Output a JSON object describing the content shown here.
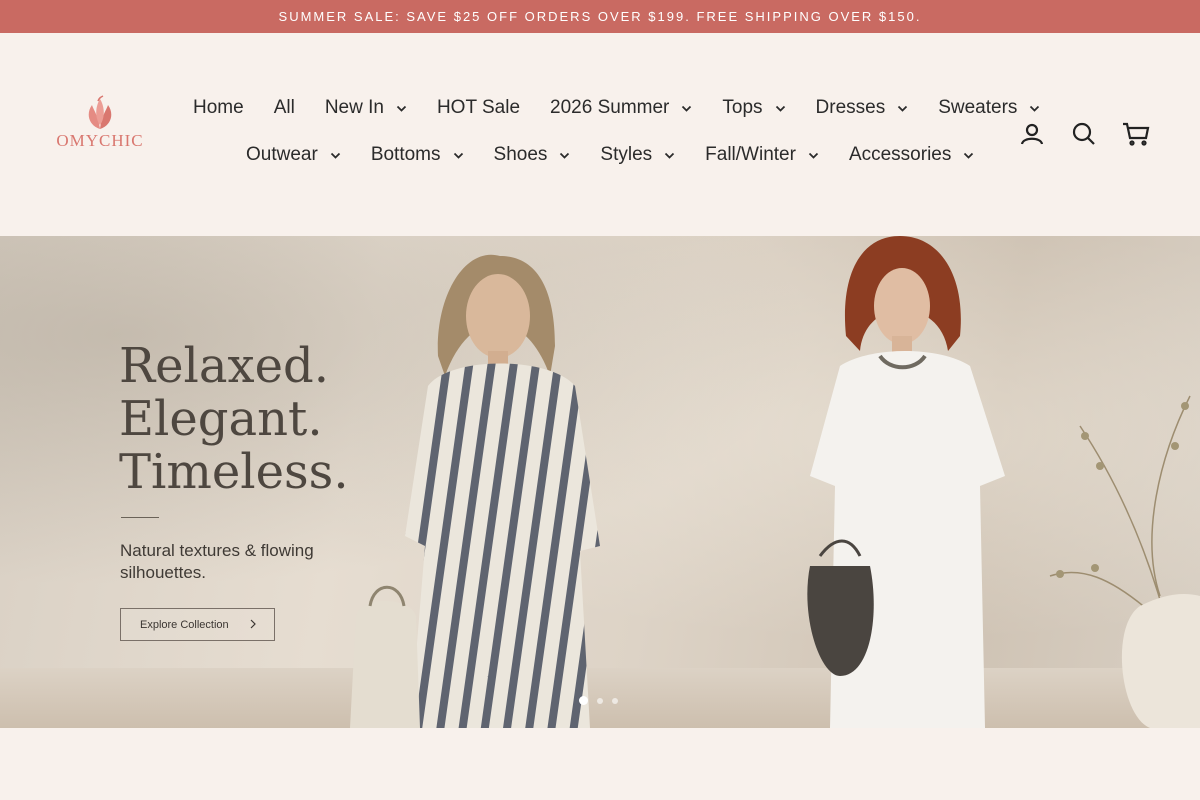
{
  "announcement": "SUMMER SALE: SAVE $25 OFF ORDERS OVER $199. FREE SHIPPING OVER $150.",
  "brand": {
    "logo_text": "OMYCHIC",
    "accent": "#d9776f"
  },
  "nav": {
    "row1": [
      {
        "label": "Home",
        "dropdown": false
      },
      {
        "label": "All",
        "dropdown": false
      },
      {
        "label": "New In",
        "dropdown": true
      },
      {
        "label": "HOT Sale",
        "dropdown": false
      },
      {
        "label": "2026 Summer",
        "dropdown": true
      },
      {
        "label": "Tops",
        "dropdown": true
      },
      {
        "label": "Dresses",
        "dropdown": true
      },
      {
        "label": "Sweaters",
        "dropdown": true
      }
    ],
    "row2": [
      {
        "label": "Outwear",
        "dropdown": true
      },
      {
        "label": "Bottoms",
        "dropdown": true
      },
      {
        "label": "Shoes",
        "dropdown": true
      },
      {
        "label": "Styles",
        "dropdown": true
      },
      {
        "label": "Fall/Winter",
        "dropdown": true
      },
      {
        "label": "Accessories",
        "dropdown": true
      }
    ]
  },
  "header_icons": [
    "account-icon",
    "search-icon",
    "cart-icon"
  ],
  "hero": {
    "headline": [
      "Relaxed.",
      "Elegant.",
      "Timeless."
    ],
    "subtext": "Natural textures & flowing silhouettes.",
    "button_label": "Explore Collection",
    "slides": 3,
    "active_slide": 1
  },
  "colors": {
    "announcement_bg": "#c96a62",
    "page_bg": "#f8f1ec"
  }
}
